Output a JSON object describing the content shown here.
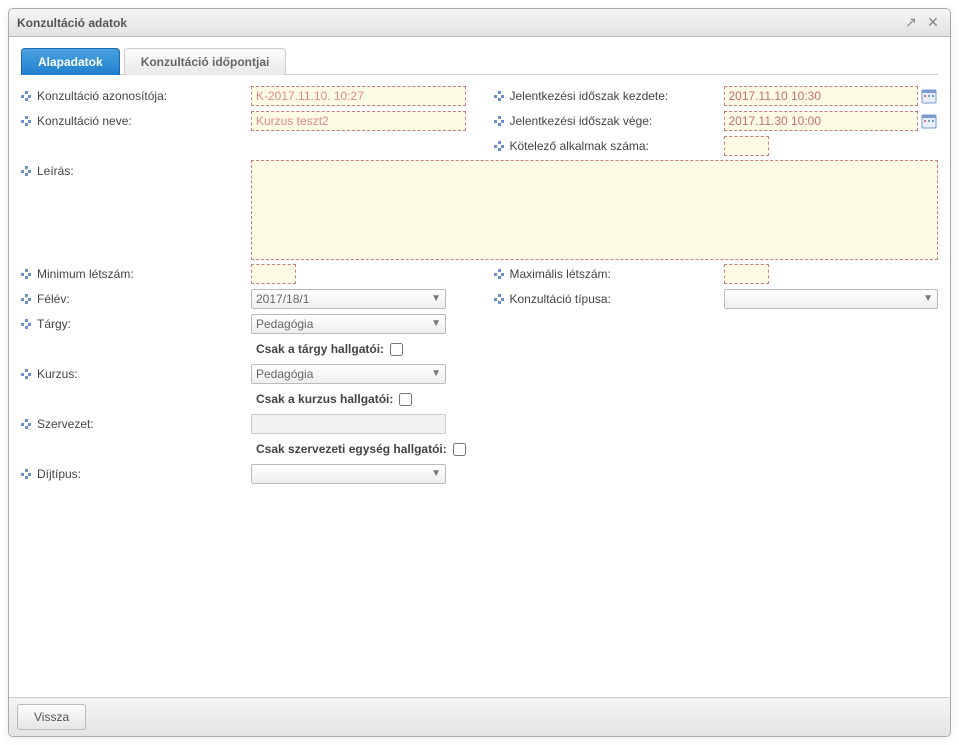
{
  "dialog": {
    "title": "Konzultáció adatok",
    "expand_icon": "↗",
    "close_icon": "✕"
  },
  "tabs": {
    "basic": "Alapadatok",
    "times": "Konzultáció időpontjai"
  },
  "labels": {
    "id": "Konzultáció azonosítója:",
    "name": "Konzultáció neve:",
    "reg_start": "Jelentkezési időszak kezdete:",
    "reg_end": "Jelentkezési időszak vége:",
    "required_sessions": "Kötelező alkalmak száma:",
    "description": "Leírás:",
    "min": "Minimum létszám:",
    "max": "Maximális létszám:",
    "semester": "Félév:",
    "type": "Konzultáció típusa:",
    "subject": "Tárgy:",
    "subject_only": "Csak a tárgy hallgatói:",
    "course": "Kurzus:",
    "course_only": "Csak a kurzus hallgatói:",
    "org": "Szervezet:",
    "org_only": "Csak szervezeti egység hallgatói:",
    "fee_type": "Díjtípus:"
  },
  "values": {
    "id": "K-2017.11.10. 10:27",
    "name": "Kurzus teszt2",
    "reg_start": "2017.11.10 10:30",
    "reg_end": "2017.11.30 10:00",
    "required_sessions": "",
    "description": "",
    "min": "",
    "max": "",
    "semester": "2017/18/1",
    "type": "",
    "subject": "Pedagógia",
    "subject_only_checked": false,
    "course": "Pedagógia",
    "course_only_checked": false,
    "org": "",
    "org_only_checked": false,
    "fee_type": ""
  },
  "footer": {
    "back": "Vissza"
  },
  "icons": {
    "calendar": "calendar-icon",
    "dropdown": "▼"
  }
}
